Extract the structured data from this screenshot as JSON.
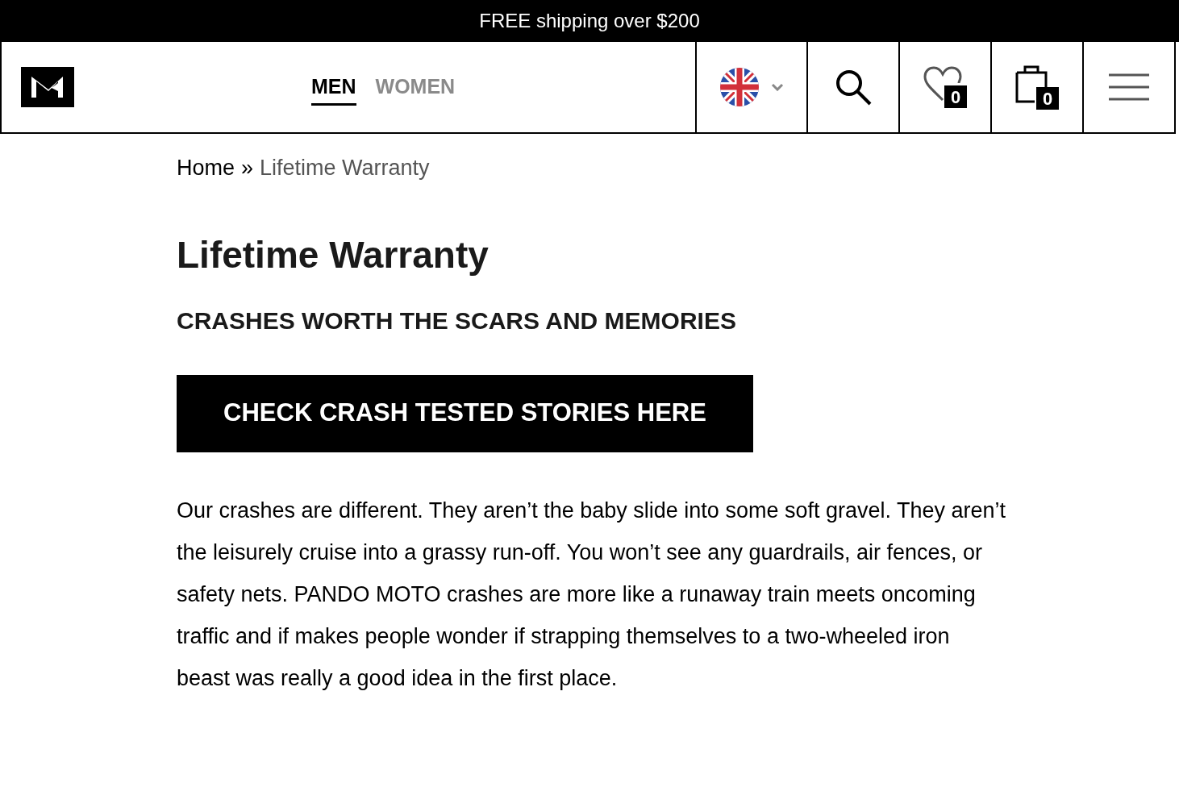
{
  "announcement": "FREE shipping over $200",
  "nav_tabs": [
    {
      "label": "MEN",
      "selected": true
    },
    {
      "label": "WOMEN",
      "selected": false
    }
  ],
  "wishlist_count": "0",
  "cart_count": "0",
  "breadcrumb": {
    "home": "Home",
    "separator": "»",
    "current": "Lifetime Warranty"
  },
  "title": "Lifetime Warranty",
  "subtitle": "CRASHES WORTH THE SCARS AND MEMORIES",
  "cta_button": "CHECK CRASH TESTED STORIES HERE",
  "body": "Our crashes are different. They aren’t the baby slide into some soft gravel. They aren’t the leisurely cruise into a grassy run-off. You won’t see any guardrails, air fences, or safety nets. PANDO MOTO crashes are more like a runaway train meets oncoming traffic and if makes people wonder if strapping themselves to a two-wheeled iron beast was really a good idea in the first place."
}
